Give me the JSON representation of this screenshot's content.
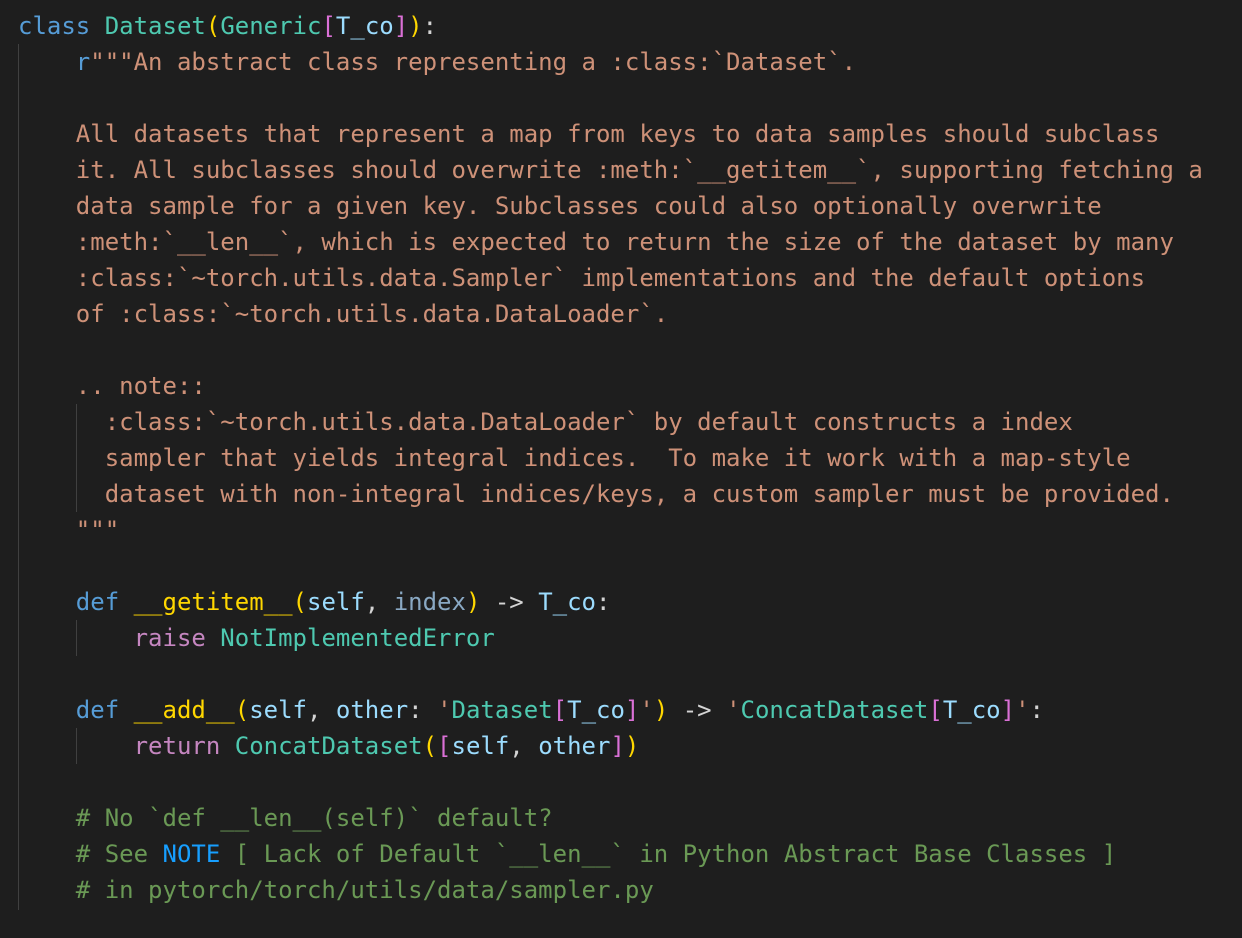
{
  "lines": [
    {
      "tokens": [
        {
          "t": "class ",
          "c": "kw-blue"
        },
        {
          "t": "Dataset",
          "c": "cls"
        },
        {
          "t": "(",
          "c": "b1"
        },
        {
          "t": "Generic",
          "c": "cls"
        },
        {
          "t": "[",
          "c": "b2"
        },
        {
          "t": "T_co",
          "c": "param"
        },
        {
          "t": "]",
          "c": "b2"
        },
        {
          "t": ")",
          "c": "b1"
        },
        {
          "t": ":",
          "c": "op"
        }
      ]
    },
    {
      "tokens": [
        {
          "t": "    ",
          "c": "op"
        },
        {
          "t": "r",
          "c": "kw-blue"
        },
        {
          "t": "\"\"\"An abstract class representing a :class:`Dataset`.",
          "c": "str"
        }
      ]
    },
    {
      "tokens": []
    },
    {
      "tokens": [
        {
          "t": "    All datasets that represent a map from keys to data samples should subclass",
          "c": "str"
        }
      ]
    },
    {
      "tokens": [
        {
          "t": "    it. All subclasses should overwrite :meth:`__getitem__`, supporting fetching a",
          "c": "str"
        }
      ]
    },
    {
      "tokens": [
        {
          "t": "    data sample for a given key. Subclasses could also optionally overwrite",
          "c": "str"
        }
      ]
    },
    {
      "tokens": [
        {
          "t": "    :meth:`__len__`, which is expected to return the size of the dataset by many",
          "c": "str"
        }
      ]
    },
    {
      "tokens": [
        {
          "t": "    :class:`~torch.utils.data.Sampler` implementations and the default options",
          "c": "str"
        }
      ]
    },
    {
      "tokens": [
        {
          "t": "    of :class:`~torch.utils.data.DataLoader`.",
          "c": "str"
        }
      ]
    },
    {
      "tokens": []
    },
    {
      "tokens": [
        {
          "t": "    .. note::",
          "c": "str"
        }
      ]
    },
    {
      "tokens": [
        {
          "t": "      :class:`~torch.utils.data.DataLoader` by default constructs a index",
          "c": "str"
        }
      ]
    },
    {
      "tokens": [
        {
          "t": "      sampler that yields integral indices.  To make it work with a map-style",
          "c": "str"
        }
      ]
    },
    {
      "tokens": [
        {
          "t": "      dataset with non-integral indices/keys, a custom sampler must be provided.",
          "c": "str"
        }
      ]
    },
    {
      "tokens": [
        {
          "t": "    \"\"\"",
          "c": "str"
        }
      ]
    },
    {
      "tokens": []
    },
    {
      "tokens": [
        {
          "t": "    ",
          "c": "op"
        },
        {
          "t": "def ",
          "c": "kw-blue"
        },
        {
          "t": "__getitem__",
          "c": "b1"
        },
        {
          "t": "(",
          "c": "b1"
        },
        {
          "t": "self",
          "c": "param"
        },
        {
          "t": ", ",
          "c": "op"
        },
        {
          "t": "index",
          "c": "param-dim"
        },
        {
          "t": ")",
          "c": "b1"
        },
        {
          "t": " -> ",
          "c": "op"
        },
        {
          "t": "T_co",
          "c": "param"
        },
        {
          "t": ":",
          "c": "op"
        }
      ]
    },
    {
      "tokens": [
        {
          "t": "        ",
          "c": "op"
        },
        {
          "t": "raise ",
          "c": "kw-purple"
        },
        {
          "t": "NotImplementedError",
          "c": "cls"
        }
      ]
    },
    {
      "tokens": []
    },
    {
      "tokens": [
        {
          "t": "    ",
          "c": "op"
        },
        {
          "t": "def ",
          "c": "kw-blue"
        },
        {
          "t": "__add__",
          "c": "b1"
        },
        {
          "t": "(",
          "c": "b1"
        },
        {
          "t": "self",
          "c": "param"
        },
        {
          "t": ", ",
          "c": "op"
        },
        {
          "t": "other",
          "c": "param"
        },
        {
          "t": ": ",
          "c": "op"
        },
        {
          "t": "'",
          "c": "str"
        },
        {
          "t": "Dataset",
          "c": "cls"
        },
        {
          "t": "[",
          "c": "b2"
        },
        {
          "t": "T_co",
          "c": "param"
        },
        {
          "t": "]",
          "c": "b2"
        },
        {
          "t": "'",
          "c": "str"
        },
        {
          "t": ")",
          "c": "b1"
        },
        {
          "t": " -> ",
          "c": "op"
        },
        {
          "t": "'",
          "c": "str"
        },
        {
          "t": "ConcatDataset",
          "c": "cls"
        },
        {
          "t": "[",
          "c": "b2"
        },
        {
          "t": "T_co",
          "c": "param"
        },
        {
          "t": "]",
          "c": "b2"
        },
        {
          "t": "'",
          "c": "str"
        },
        {
          "t": ":",
          "c": "op"
        }
      ]
    },
    {
      "tokens": [
        {
          "t": "        ",
          "c": "op"
        },
        {
          "t": "return ",
          "c": "kw-purple"
        },
        {
          "t": "ConcatDataset",
          "c": "cls"
        },
        {
          "t": "(",
          "c": "b1"
        },
        {
          "t": "[",
          "c": "b2"
        },
        {
          "t": "self",
          "c": "param"
        },
        {
          "t": ", ",
          "c": "op"
        },
        {
          "t": "other",
          "c": "param"
        },
        {
          "t": "]",
          "c": "b2"
        },
        {
          "t": ")",
          "c": "b1"
        }
      ]
    },
    {
      "tokens": []
    },
    {
      "tokens": [
        {
          "t": "    # No `def __len__(self)` default?",
          "c": "com"
        }
      ]
    },
    {
      "tokens": [
        {
          "t": "    # See ",
          "c": "com"
        },
        {
          "t": "NOTE",
          "c": "b3"
        },
        {
          "t": " [ Lack of Default `__len__` in Python Abstract Base Classes ]",
          "c": "com"
        }
      ]
    },
    {
      "tokens": [
        {
          "t": "    # in pytorch/torch/utils/data/sampler.py",
          "c": "com"
        }
      ]
    }
  ],
  "colors": {
    "background": "#1e1e1e",
    "keyword": "#569cd6",
    "control": "#c586c0",
    "class": "#4ec9b0",
    "variable": "#9cdcfe",
    "string": "#ce9178",
    "comment": "#6a9955",
    "bracket_1": "#ffd700",
    "bracket_2": "#da70d6"
  }
}
